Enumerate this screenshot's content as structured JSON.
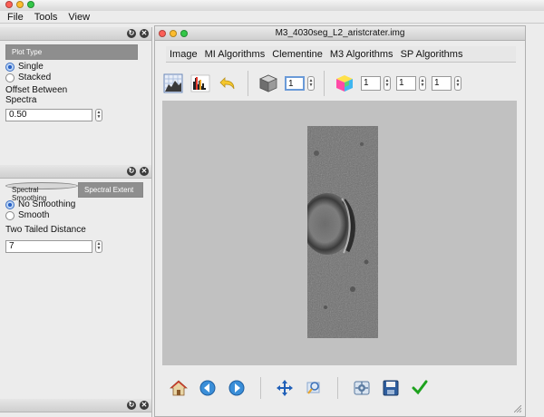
{
  "app_menu": [
    "File",
    "Tools",
    "View"
  ],
  "panel1": {
    "tab_label": "Plot Type",
    "radios": [
      {
        "label": "Single",
        "selected": true
      },
      {
        "label": "Stacked",
        "selected": false
      }
    ],
    "offset_label_line1": "Offset Between",
    "offset_label_line2": "Spectra",
    "offset_value": "0.50"
  },
  "panel2": {
    "tabs": [
      {
        "label": "Spectral Smoothing",
        "active": true
      },
      {
        "label": "Spectral Extent",
        "active": false
      }
    ],
    "radios": [
      {
        "label": "No Smoothing",
        "selected": true
      },
      {
        "label": "Smooth",
        "selected": false
      }
    ],
    "distance_label": "Two Tailed Distance",
    "distance_value": "7"
  },
  "main": {
    "title": "M3_4030seg_L2_aristcrater.img",
    "menu": [
      "Image",
      "MI Algorithms",
      "Clementine",
      "M3 Algorithms",
      "SP Algorithms"
    ],
    "band_value": "1",
    "rgb_values": [
      "1",
      "1",
      "1"
    ]
  },
  "icons": {
    "toolbar": [
      "image-stats-icon",
      "histogram-icon",
      "undo-icon",
      "cube-icon",
      "color-cube-icon"
    ],
    "bottom": [
      "home-icon",
      "back-icon",
      "forward-icon",
      "pan-icon",
      "zoom-icon",
      "settings-icon",
      "save-icon",
      "check-icon"
    ]
  },
  "colors": {
    "viewer_bg": "#c1c1c1",
    "accent": "#2b63c6"
  }
}
